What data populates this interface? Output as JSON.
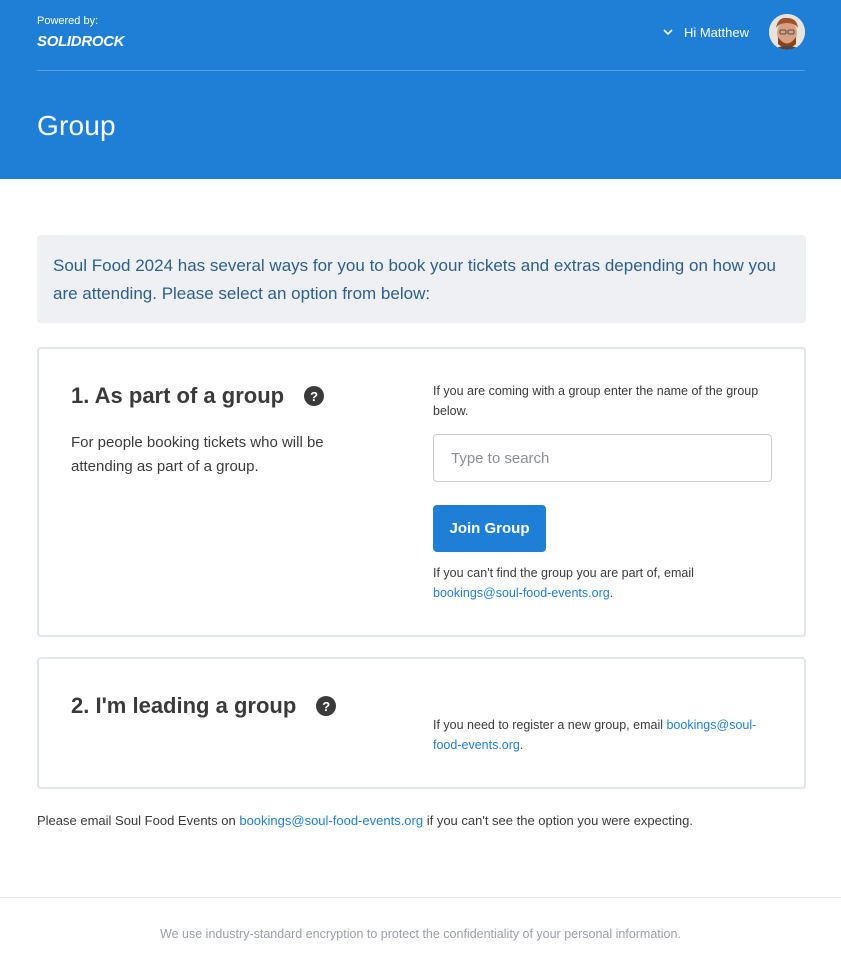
{
  "header": {
    "powered_by": "Powered by:",
    "logo_text": "SOLIDROCK",
    "greeting": "Hi Matthew",
    "page_title": "Group",
    "brand_color": "#1f7ed6"
  },
  "intro": {
    "text": "Soul Food 2024 has several ways for you to book your tickets and extras depending on how you are attending. Please select an option from below:"
  },
  "options": [
    {
      "title": "1. As part of a group",
      "help_icon": "?",
      "description": "For people booking tickets who will be attending as part of a group.",
      "prompt": "If you are coming with a group enter the name of the group below.",
      "search_placeholder": "Type to search",
      "button_label": "Join Group",
      "hint_before": "If you can't find the group you are part of, email ",
      "email": "bookings@soul-food-events.org",
      "hint_after": "."
    },
    {
      "title": "2. I'm leading a group",
      "help_icon": "?",
      "hint_before": "If you need to register a new group, email ",
      "email": "bookings@soul-food-events.org",
      "hint_after": "."
    }
  ],
  "note": {
    "before": "Please email Soul Food Events on ",
    "email": "bookings@soul-food-events.org",
    "after": " if you can't see the option you were expecting."
  },
  "footer": {
    "text": "We use industry-standard encryption to protect the confidentiality of your personal information."
  }
}
